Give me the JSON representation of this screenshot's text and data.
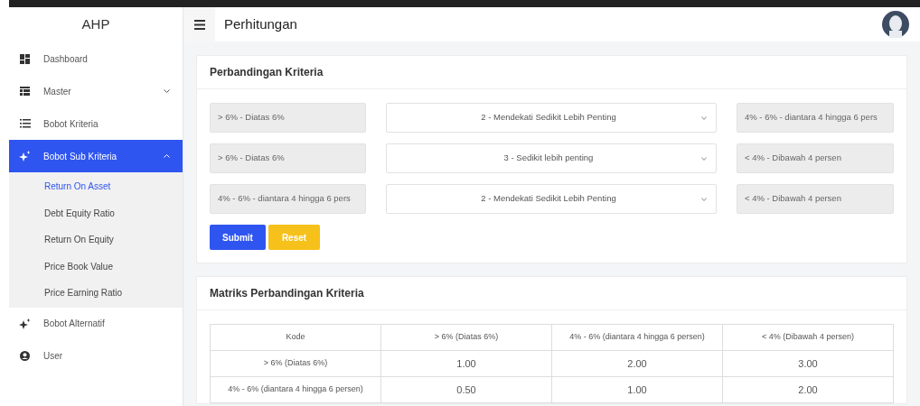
{
  "sidebar": {
    "brand": "AHP",
    "items": [
      {
        "label": "Dashboard",
        "selected": false
      },
      {
        "label": "Master",
        "selected": false,
        "expanded": false
      },
      {
        "label": "Bobot Kriteria",
        "selected": false
      },
      {
        "label": "Bobot Sub Kriteria",
        "selected": true,
        "expanded": true,
        "children": [
          {
            "label": "Return On Asset",
            "selected": true
          },
          {
            "label": "Debt Equity Ratio",
            "selected": false
          },
          {
            "label": "Return On Equity",
            "selected": false
          },
          {
            "label": "Price Book Value",
            "selected": false
          },
          {
            "label": "Price Earning Ratio",
            "selected": false
          }
        ]
      },
      {
        "label": "Bobot Alternatif",
        "selected": false
      },
      {
        "label": "User",
        "selected": false
      }
    ]
  },
  "header": {
    "title": "Perhitungan"
  },
  "comparison": {
    "title": "Perbandingan Kriteria",
    "rows": [
      {
        "left": "> 6% - Diatas 6%",
        "choice": "2 - Mendekati Sedikit Lebih Penting",
        "right": "4% - 6% - diantara 4 hingga 6 pers"
      },
      {
        "left": "> 6% - Diatas 6%",
        "choice": "3 - Sedikit lebih penting",
        "right": "< 4% - Dibawah 4 persen"
      },
      {
        "left": "4% - 6% - diantara 4 hingga 6 pers",
        "choice": "2 - Mendekati Sedikit Lebih Penting",
        "right": "< 4% - Dibawah 4 persen"
      }
    ],
    "buttons": [
      {
        "label": "Submit",
        "kind": "primary"
      },
      {
        "label": "Reset",
        "kind": "warning"
      }
    ]
  },
  "matrix": {
    "title": "Matriks Perbandingan Kriteria",
    "table": {
      "columns": [
        "Kode",
        "> 6% (Diatas 6%)",
        "4% - 6% (diantara 4 hingga 6 persen)",
        "< 4% (Dibawah 4 persen)"
      ],
      "rows": [
        [
          "> 6% (Diatas 6%)",
          "1.00",
          "2.00",
          "3.00"
        ],
        [
          "4% - 6% (diantara 4 hingga 6 persen)",
          "0.50",
          "1.00",
          "2.00"
        ]
      ]
    }
  }
}
